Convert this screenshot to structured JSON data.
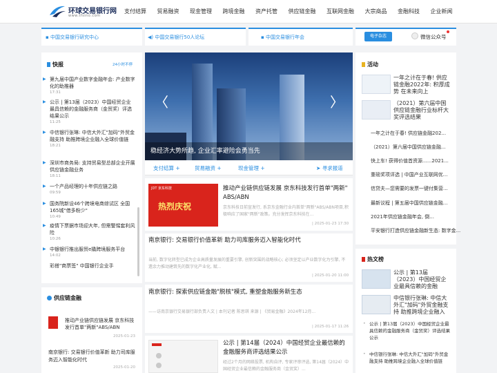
{
  "header": {
    "logo_name": "环球交易银行网",
    "logo_url": "www.tfsino.com",
    "nav": [
      "支付结算",
      "贸易融资",
      "现金管理",
      "跨境金融",
      "资产托管",
      "供应链金融",
      "互联网金融",
      "大宗商品",
      "金融科技",
      "企业新闻"
    ]
  },
  "topbar": {
    "items": [
      "中国交易银行研究中心",
      "中国交易银行50人论坛",
      "中国交易银行年会"
    ],
    "ebook_label": "电子杂志",
    "wechat_label": "微信公众号"
  },
  "kuaibao": {
    "title": "快报",
    "more": "24小时不停",
    "items": [
      {
        "text": "第九届中国产业数字金融年会: 产业数字化的助推器",
        "time": "17:31"
      },
      {
        "text": "公示 | 第13届（2023）中国经贸企业最具信赖的金融服务商（金贸奖）评选结果公示",
        "time": "11:25"
      },
      {
        "text": "中信银行张琳: 中信大外汇\"加码\"外贸金融支持 助推跨境企业融入全球价值链",
        "time": "18:21"
      },
      {
        "text": "深圳市商务局: 支持贸易型总部企业开展供应链金融业务",
        "time": "18:11"
      },
      {
        "text": "一个产品经理的十年供应链之路",
        "time": "09:59"
      },
      {
        "text": "国务院新设46个跨境电商综试区 全国165城\"借多粉少\"",
        "time": "10:49"
      },
      {
        "text": "疫情下票据市场迎大年, 但需警惕套利风险",
        "time": "10:26"
      },
      {
        "text": "中银银行推出服贸e撬跨境服务平台",
        "time": "14:02"
      },
      {
        "text": "彩搭\"商票签\" 中国银行企业手",
        "time": ""
      }
    ]
  },
  "supply": {
    "title": "供应链金融",
    "items": [
      {
        "text": "推动产业链供应链发展 京东科技发行首单\"两新\"ABS/ABN",
        "time": "2025-01-23"
      },
      {
        "text": "南京银行: 交易银行价值革新 助力司库服务迈入智能化时代",
        "time": "2025-01-20"
      }
    ]
  },
  "banner": {
    "caption": "稳经济大势所趋, 企业汇率避险会勇当先"
  },
  "tabs": {
    "items": [
      "支付结算",
      "贸易融资",
      "现金管理"
    ],
    "plus": "+",
    "request": "寻求报道"
  },
  "news": [
    {
      "title": "推动产业链供应链发展 京东科技发行首单\"两新\" ABS/ABN",
      "summary": "京东科技日前宣发行, 系京东金融行业内首单\"两新\"ABS/ABN项目,积极响应了国家\"两新\"政策。充分发挥京东科技在...",
      "time": "| 2025-01-23 17:30",
      "thumb_title": "热烈庆祝",
      "thumb_brand": "JDT 京东科技"
    },
    {
      "title": "南京银行: 交易银行价值革新 助力司库服务迈入智能化时代",
      "summary": "当前, 数字化转型已成为企业高质量发展的重要引擎, 创新突围的战略核心; 必须坚定以产业数字化为引擎, 不遗余力推动建筑先的数字化产业化, 赋...",
      "time": "| 2025-01-20 11:00"
    },
    {
      "title": "南京银行: 探索供应链金融\"脱核\"模式, 重塑金融服务新生态",
      "summary": "——访南京银行交易银行部负责人文 | 本刊记者 陈思琪 来源 | 《贸易金融》2024年12月...",
      "time": "| 2025-01-17 11:26"
    },
    {
      "title": "公示 | 第14届（2024）中国经贸企业最信赖的金融服务商评选结果公示",
      "summary": "经过2个月的网络投票, 机构自评, 专家评审评选, 第14届（2024）中国经贸企业最信赖的金融服务商（金贸奖）..."
    }
  ],
  "activity": {
    "title": "活动",
    "featured": [
      {
        "text": "一年之计在于春! 供应链金融2022年: 积厚成势 在未来向上"
      },
      {
        "text": "（2021）第六届中国供应链金融行业标杆大奖评选结果"
      }
    ],
    "list": [
      "一年之计在于春! 供应链金融202...",
      "（2021）第六届中国供应链金融...",
      "快上车! 获得价值首资源......2021...",
      "重磅奖项评选 | 中国产业互联网优...",
      "信贷夫—您需要的发票一键付集营...",
      "最新议程 | 第五届中国供应链金融...",
      "2021年供应链金融年会, 倒...",
      "平安银行打造供应链金融新生态: 数字金..."
    ]
  },
  "hot": {
    "title": "热文榜",
    "featured": [
      {
        "text": "公示 | 第13届（2023）中国经贸企业最具信赖的金融"
      },
      {
        "text": "中信银行张琳: 中信大外汇\"加码\"外贸金融支持 助推跨境企业融入全球价"
      }
    ],
    "list": [
      "公示 | 第13届（2023）中国经贸企业最具信赖的金融服务商（金贸奖）评选结果公示",
      "中信银行张琳: 中信大外汇\"加码\"外贸金融支持 助推跨境企业融入全球价值链"
    ]
  },
  "colors": {
    "accent": "#2a8ee0",
    "header_text": "#1a2c5a",
    "banner_sky": "#3e6fae",
    "thumb_red": "#d9241c"
  }
}
